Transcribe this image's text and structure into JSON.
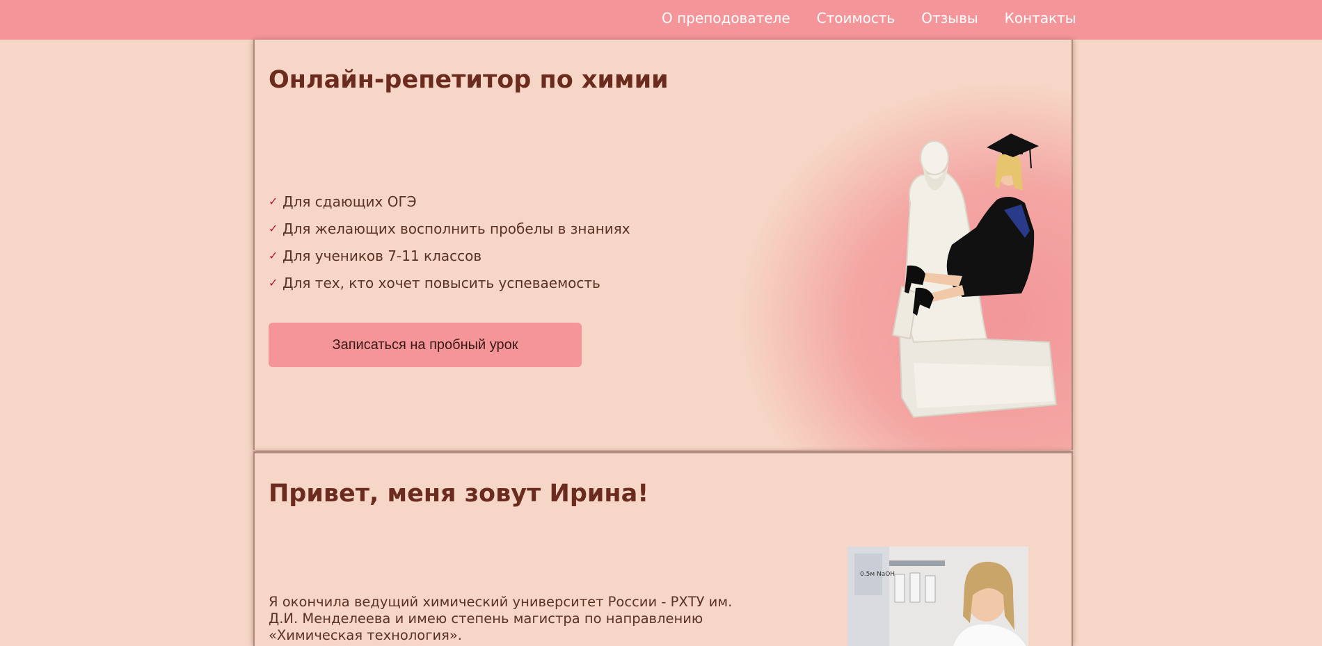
{
  "nav": {
    "items": [
      "О преподователе",
      "Стоимость",
      "Отзывы",
      "Контакты"
    ]
  },
  "hero": {
    "title": "Онлайн-репетитор по химии",
    "benefits": [
      "Для сдающих ОГЭ",
      "Для желающих восполнить пробелы в знаниях",
      "Для учеников 7-11 классов",
      "Для тех, кто хочет повысить успеваемость"
    ],
    "cta_label": "Записаться на пробный урок"
  },
  "about": {
    "title": "Привет, меня зовут Ирина!",
    "bio_lines": [
      "Я окончила ведущий химический университет России - РХТУ им.",
      "Д.И. Менделеева и имею степень магистра по направлению",
      "«Химическая технология»."
    ],
    "lab_label": "0.5м NaOH"
  },
  "colors": {
    "background": "#f6d6c6",
    "header": "#f4959a",
    "heading": "#6b2c1f",
    "check": "#b3123a"
  },
  "icons": {
    "benefit_marker": "checkmark-icon"
  }
}
